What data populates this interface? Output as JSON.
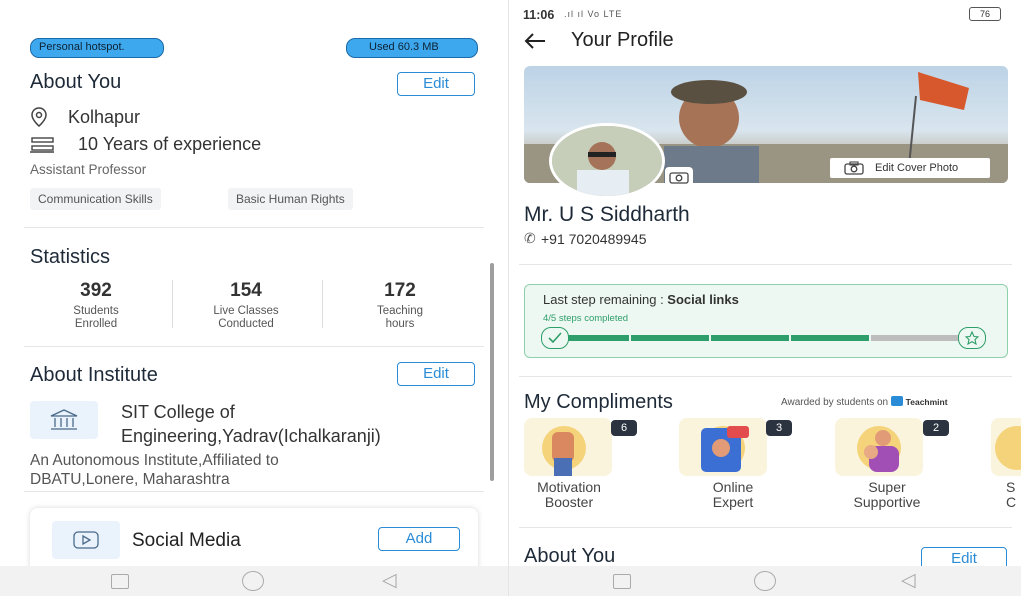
{
  "left": {
    "hotspot_label": "Personal hotspot.",
    "data_used": "Used 60.3 MB",
    "about_you": {
      "title": "About You",
      "edit_label": "Edit",
      "location": "Kolhapur",
      "experience": "10 Years of experience",
      "role": "Assistant Professor",
      "skills": [
        "Communication Skills",
        "Basic Human Rights"
      ]
    },
    "statistics": {
      "title": "Statistics",
      "items": [
        {
          "value": "392",
          "label_line1": "Students",
          "label_line2": "Enrolled"
        },
        {
          "value": "154",
          "label_line1": "Live Classes",
          "label_line2": "Conducted"
        },
        {
          "value": "172",
          "label_line1": "Teaching",
          "label_line2": "hours"
        }
      ]
    },
    "about_institute": {
      "title": "About Institute",
      "edit_label": "Edit",
      "name_line1": "SIT College of",
      "name_line2": "Engineering,Yadrav(Ichalkaranji)",
      "desc_line1": "An Autonomous Institute,Affiliated to",
      "desc_line2": "DBATU,Lonere, Maharashtra"
    },
    "social_media": {
      "title": "Social Media",
      "add_label": "Add"
    }
  },
  "right": {
    "status_bar": {
      "time": "11:06",
      "signal_text": "Vo LTE",
      "battery": "76"
    },
    "header": {
      "title": "Your Profile"
    },
    "edit_cover_label": "Edit Cover Photo",
    "name": "Mr. U S Siddharth",
    "phone": "+91 7020489945",
    "progress": {
      "title_prefix": "Last step remaining : ",
      "title_bold": "Social links",
      "steps_text": "4/5 steps completed",
      "completed_steps": 4,
      "total_steps": 5
    },
    "compliments": {
      "title": "My Compliments",
      "awarded_by": "Awarded by students on",
      "brand": "Teachmint",
      "items": [
        {
          "count": "6",
          "label_line1": "Motivation",
          "label_line2": "Booster"
        },
        {
          "count": "3",
          "label_line1": "Online",
          "label_line2": "Expert"
        },
        {
          "count": "2",
          "label_line1": "Super",
          "label_line2": "Supportive"
        },
        {
          "count": "",
          "label_line1": "S",
          "label_line2": "C"
        }
      ]
    },
    "about_you": {
      "title": "About You",
      "edit_label": "Edit"
    }
  },
  "colors": {
    "accent": "#2a8bd6",
    "hotspot_pill": "#3ea8ee",
    "progress_green": "#2e9e6a",
    "progress_bg": "#eef8f2",
    "heading": "#1e2a38"
  },
  "icons": [
    "location-pin-icon",
    "experience-icon",
    "bank-icon",
    "video-play-icon",
    "back-arrow-icon",
    "camera-icon",
    "check-icon",
    "star-icon",
    "teachmint-logo-icon"
  ]
}
